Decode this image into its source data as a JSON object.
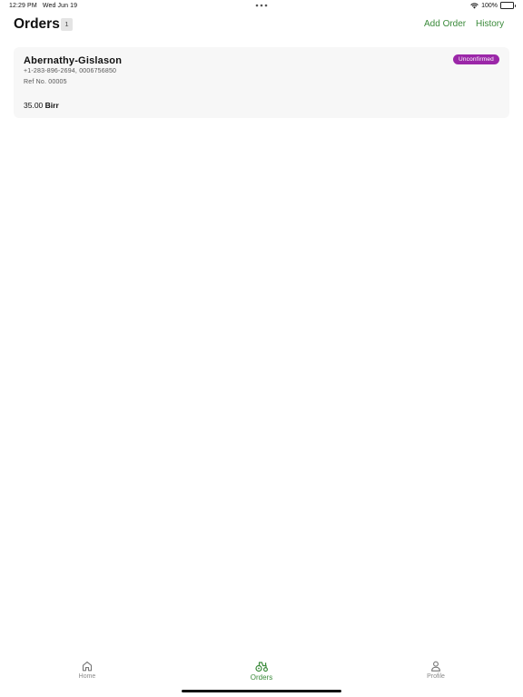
{
  "status_bar": {
    "time": "12:29 PM",
    "date": "Wed Jun 19",
    "battery": "100%"
  },
  "header": {
    "title": "Orders",
    "count": "1",
    "add_order_label": "Add Order",
    "history_label": "History"
  },
  "orders": [
    {
      "customer_name": "Abernathy-Gislason",
      "phones": "+1-283-896-2694, 0006756850",
      "ref": "Ref No. 00005",
      "status": "Unconfirmed",
      "amount": "35.00",
      "currency": "Birr"
    }
  ],
  "tabs": [
    {
      "label": "Home",
      "icon": "house-icon"
    },
    {
      "label": "Orders",
      "icon": "tractor-icon",
      "active": true
    },
    {
      "label": "Profile",
      "icon": "person-icon"
    }
  ],
  "colors": {
    "accent": "#3a8a3a",
    "status_unconfirmed": "#9b27a8",
    "card_background": "#f7f7f7",
    "inactive_tab": "#8a8a8a"
  }
}
